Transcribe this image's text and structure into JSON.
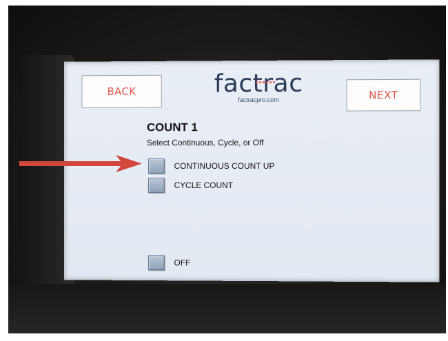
{
  "screen": {
    "back_label": "BACK",
    "next_label": "NEXT",
    "logo_text": "factrac",
    "logo_url_text": "factracpro.com",
    "title": "COUNT 1",
    "subtitle": "Select Continuous, Cycle, or Off",
    "options": [
      {
        "label": "CONTINUOUS COUNT UP"
      },
      {
        "label": "CYCLE COUNT"
      },
      {
        "label": "OFF"
      }
    ]
  },
  "colors": {
    "accent_red": "#e0524a",
    "screen_bg": "#e6ecf4",
    "checkbox_fill": "#9fb0c5",
    "logo_navy": "#2a3a58",
    "arrow_red": "#d2473c"
  },
  "icons": {
    "pointer": "arrow-right-icon",
    "checkbox": "checkbox-square-icon"
  }
}
